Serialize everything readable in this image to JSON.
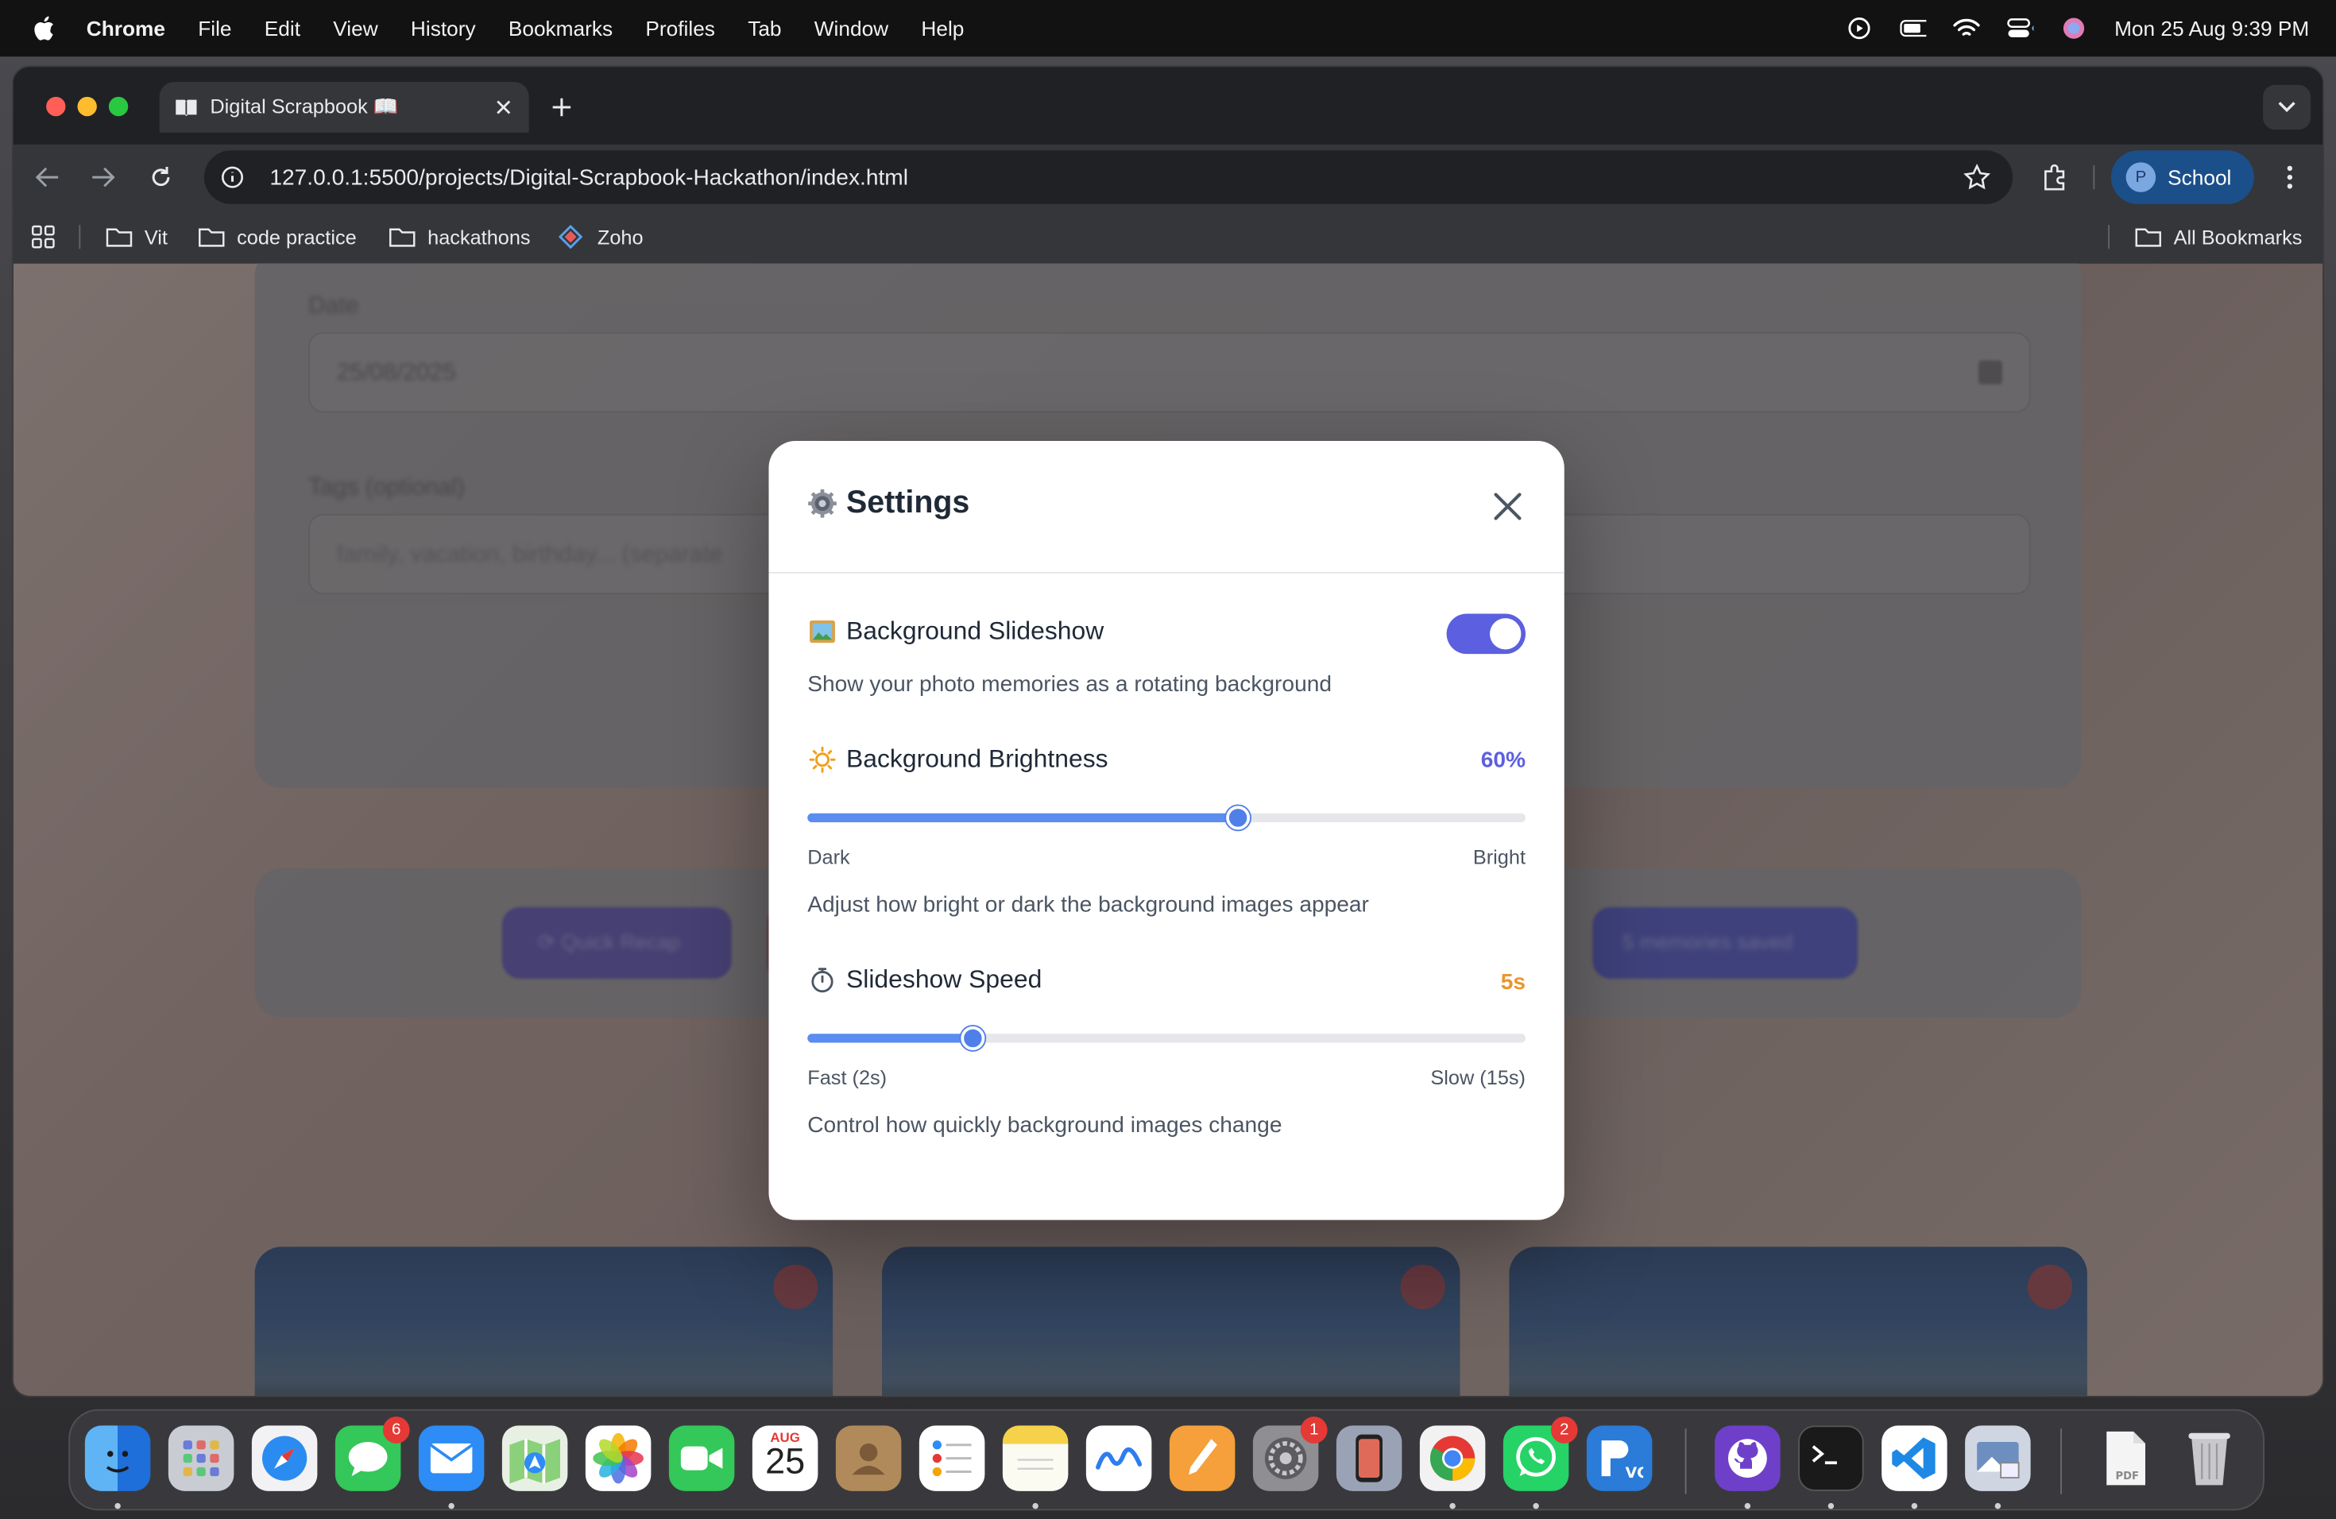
{
  "menubar": {
    "app_name": "Chrome",
    "items": [
      "File",
      "Edit",
      "View",
      "History",
      "Bookmarks",
      "Profiles",
      "Tab",
      "Window",
      "Help"
    ],
    "datetime": "Mon 25 Aug  9:39 PM"
  },
  "browser": {
    "tab_title": "Digital Scrapbook 📖",
    "url": "127.0.0.1:5500/projects/Digital-Scrapbook-Hackathon/index.html",
    "profile_initial": "P",
    "profile_name": "School",
    "bookmarks": [
      "Vit",
      "code practice",
      "hackathons",
      "Zoho"
    ],
    "all_bookmarks": "All Bookmarks"
  },
  "background_page": {
    "date_label": "Date",
    "date_value": "25/08/2025",
    "tags_label": "Tags (optional)",
    "tags_placeholder": "family, vacation, birthday... (separate",
    "quick_recap": "⟳ Quick Recap",
    "memories_saved": "5 memories saved"
  },
  "settings": {
    "title": "Settings",
    "slideshow": {
      "title": "Background Slideshow",
      "description": "Show your photo memories as a rotating background",
      "enabled": true
    },
    "brightness": {
      "title": "Background Brightness",
      "value_label": "60%",
      "value": 0.6,
      "min_label": "Dark",
      "max_label": "Bright",
      "description": "Adjust how bright or dark the background images appear",
      "color": "#5b5fe0"
    },
    "speed": {
      "title": "Slideshow Speed",
      "value_label": "5s",
      "value": 5,
      "min": 2,
      "max": 15,
      "min_label": "Fast (2s)",
      "max_label": "Slow (15s)",
      "description": "Control how quickly background images change",
      "color": "#e8962e"
    }
  },
  "dock": {
    "calendar_month": "AUG",
    "calendar_day": "25",
    "badges": {
      "messages": "6",
      "system_settings": "1",
      "whatsapp": "2"
    }
  }
}
